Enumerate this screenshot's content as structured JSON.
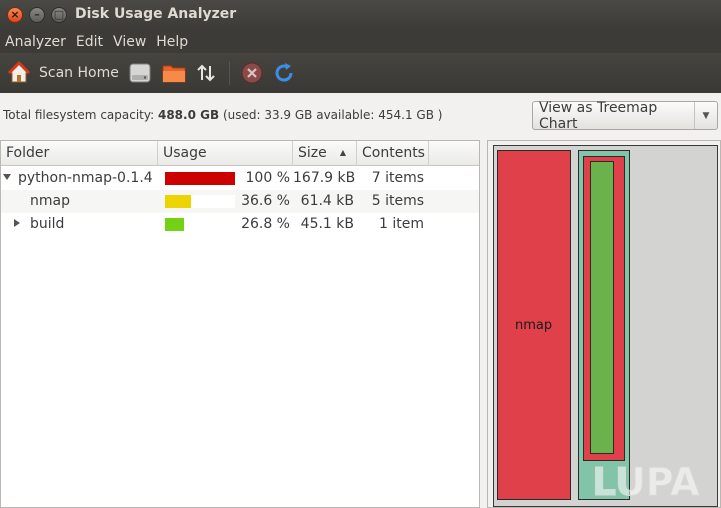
{
  "window": {
    "title": "Disk Usage Analyzer"
  },
  "menu": [
    "Analyzer",
    "Edit",
    "View",
    "Help"
  ],
  "toolbar": {
    "scan_home_label": "Scan Home",
    "icons": [
      "home-icon",
      "disk-icon",
      "folder-icon",
      "arrows-updown-icon",
      "stop-icon",
      "refresh-icon"
    ]
  },
  "info": {
    "prefix": "Total filesystem capacity:",
    "total": "488.0 GB",
    "detail": "(used: 33.9 GB available: 454.1 GB )"
  },
  "view_button": {
    "label": "View as Treemap Chart"
  },
  "columns": {
    "folder": "Folder",
    "usage": "Usage",
    "size": "Size",
    "contents": "Contents"
  },
  "rows": [
    {
      "name": "python-nmap-0.1.4",
      "percent": "100 %",
      "usage_fraction": 1.0,
      "size": "167.9 kB",
      "contents": "7 items",
      "bar_color": "#cc0000",
      "expander": "expanded",
      "indent": 0
    },
    {
      "name": "nmap",
      "percent": "36.6 %",
      "usage_fraction": 0.366,
      "size": "61.4 kB",
      "contents": "5 items",
      "bar_color": "#edd400",
      "expander": "none",
      "indent": 1
    },
    {
      "name": "build",
      "percent": "26.8 %",
      "usage_fraction": 0.268,
      "size": "45.1 kB",
      "contents": "1 item",
      "bar_color": "#73d216",
      "expander": "collapsed",
      "indent": 1
    }
  ],
  "treemap": {
    "label": "nmap"
  },
  "watermark": {
    "text": "LUPA"
  },
  "colors": {
    "treemap_red": "#e0404a",
    "treemap_teal": "#82c4a8",
    "treemap_green": "#6cb24c"
  }
}
